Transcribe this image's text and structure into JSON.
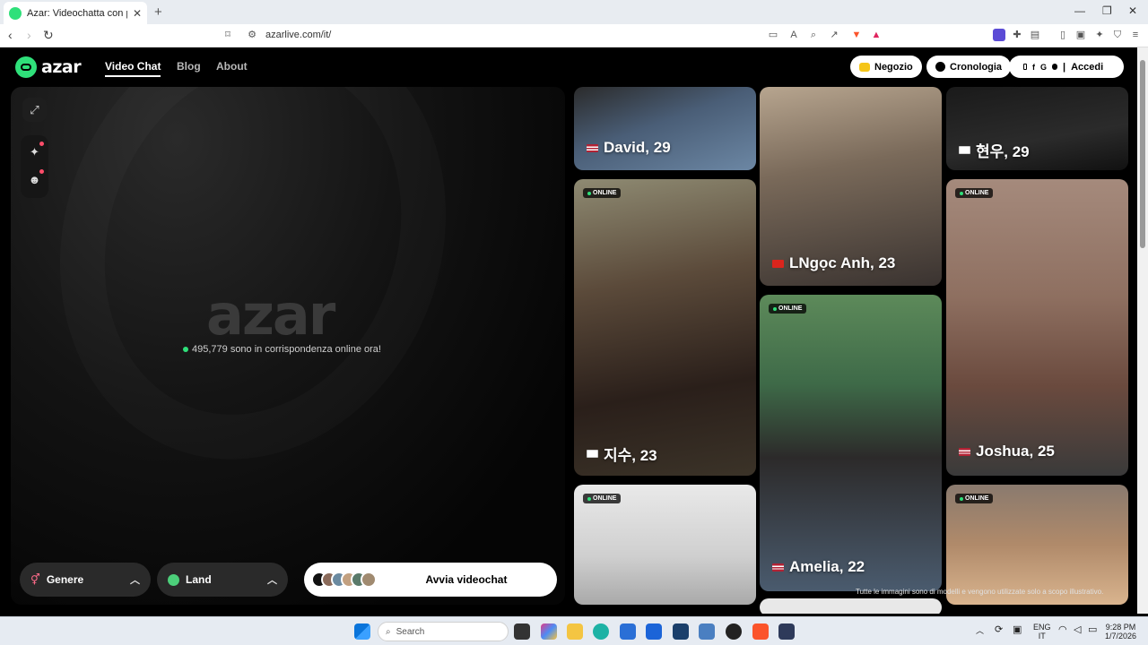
{
  "browser": {
    "tab_title": "Azar: Videochatta con persone n",
    "url": "azarlive.com/it/"
  },
  "nav": {
    "logo": "azar",
    "links": [
      "Video Chat",
      "Blog",
      "About"
    ],
    "shop_label": "Negozio",
    "history_label": "Cronologia",
    "login_label": "Accedi",
    "social_icons": [
      "",
      "f",
      "G",
      ""
    ]
  },
  "left": {
    "big_logo": "azar",
    "online_text": "495,779 sono in corrispondenza online ora!",
    "gender_label": "Genere",
    "country_label": "Land",
    "start_label": "Avvia videochat"
  },
  "cards": [
    {
      "name": "David, 29",
      "online": false
    },
    {
      "name": "지수, 23",
      "online": true,
      "badge": "ONLINE"
    },
    {
      "name": "",
      "online": true,
      "badge": "ONLINE"
    },
    {
      "name": "LNgọc Anh, 23",
      "online": false
    },
    {
      "name": "Amelia, 22",
      "online": true,
      "badge": "ONLINE"
    },
    {
      "name": "현우, 29",
      "online": false
    },
    {
      "name": "Joshua, 25",
      "online": true,
      "badge": "ONLINE"
    },
    {
      "name": "",
      "online": true,
      "badge": "ONLINE"
    }
  ],
  "disclaimer": "Tutte le immagini sono di modelli e vengono utilizzate solo a scopo illustrativo.",
  "taskbar": {
    "search_placeholder": "Search",
    "lang_top": "ENG",
    "lang_bottom": "IT",
    "time": "9:28 PM",
    "date": "1/7/2026"
  }
}
